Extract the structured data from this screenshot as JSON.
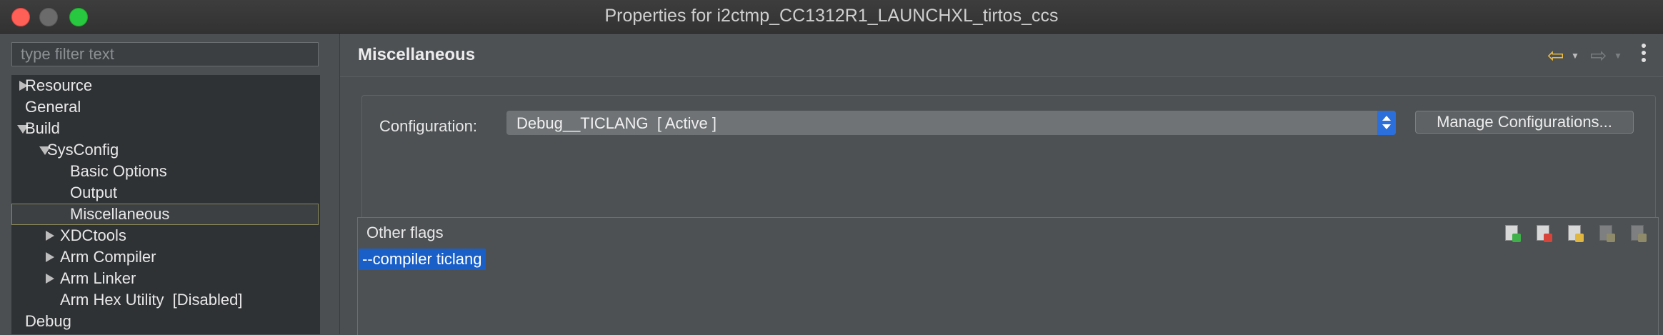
{
  "window": {
    "title": "Properties for i2ctmp_CC1312R1_LAUNCHXL_tirtos_ccs"
  },
  "filter": {
    "placeholder": "type filter text",
    "value": ""
  },
  "tree": {
    "items": [
      {
        "label": "Resource",
        "level": 0,
        "expander": "collapsed"
      },
      {
        "label": "General",
        "level": 0,
        "expander": "none"
      },
      {
        "label": "Build",
        "level": 0,
        "expander": "expanded"
      },
      {
        "label": "SysConfig",
        "level": 1,
        "expander": "expanded"
      },
      {
        "label": "Basic Options",
        "level": 2,
        "expander": "none"
      },
      {
        "label": "Output",
        "level": 2,
        "expander": "none"
      },
      {
        "label": "Miscellaneous",
        "level": 2,
        "expander": "none",
        "selected": true
      },
      {
        "label": "XDCtools",
        "level": 1,
        "expander": "collapsed"
      },
      {
        "label": "Arm Compiler",
        "level": 1,
        "expander": "collapsed"
      },
      {
        "label": "Arm Linker",
        "level": 1,
        "expander": "collapsed"
      },
      {
        "label": "Arm Hex Utility  [Disabled]",
        "level": 1,
        "expander": "none"
      },
      {
        "label": "Debug",
        "level": 0,
        "expander": "none"
      }
    ]
  },
  "page": {
    "title": "Miscellaneous",
    "nav": {
      "back_icon": "arrow-left-icon",
      "forward_icon": "arrow-right-icon",
      "menu_icon": "vertical-dots-icon"
    }
  },
  "configuration": {
    "label": "Configuration:",
    "selected": "Debug__TICLANG  [ Active ]",
    "manage_label": "Manage Configurations..."
  },
  "flags": {
    "label": "Other flags",
    "values": [
      "--compiler ticlang"
    ],
    "toolbar": [
      {
        "icon": "add-icon",
        "enabled": true
      },
      {
        "icon": "delete-icon",
        "enabled": true
      },
      {
        "icon": "edit-icon",
        "enabled": true
      },
      {
        "icon": "move-up-icon",
        "enabled": false
      },
      {
        "icon": "move-down-icon",
        "enabled": false
      }
    ]
  },
  "colors": {
    "accent": "#2a6fdb",
    "selection": "#1a5fc8",
    "back_arrow": "#f5c242"
  }
}
